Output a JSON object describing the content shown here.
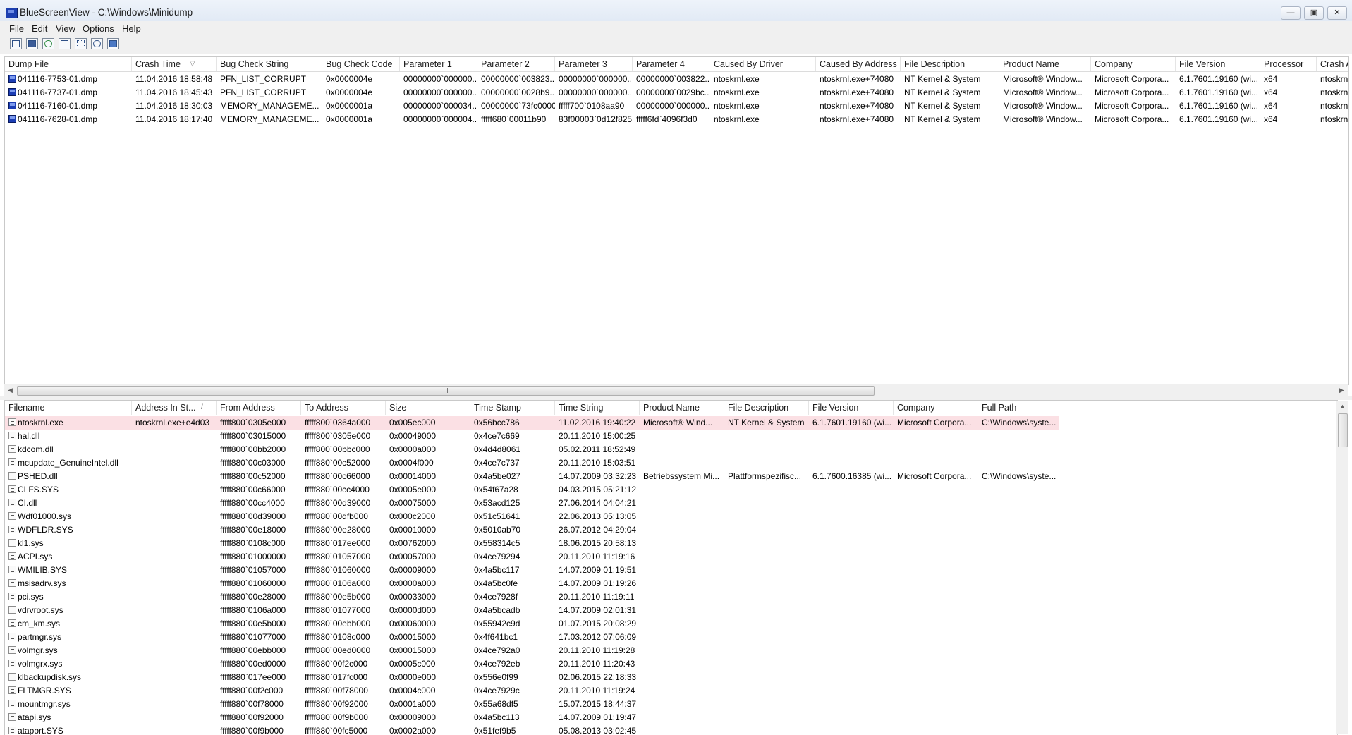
{
  "window": {
    "title": "BlueScreenView  -  C:\\Windows\\Minidump",
    "minimize": "—",
    "maximize": "▣",
    "close": "✕"
  },
  "menu": [
    "File",
    "Edit",
    "View",
    "Options",
    "Help"
  ],
  "toolbar": {
    "buttons": [
      "html-report-all-icon",
      "save-icon",
      "refresh-icon",
      "copy-icon",
      "properties-icon",
      "find-icon",
      "exit-icon"
    ]
  },
  "dumps": {
    "columns": [
      "Dump File",
      "Crash Time",
      "Bug Check String",
      "Bug Check Code",
      "Parameter 1",
      "Parameter 2",
      "Parameter 3",
      "Parameter 4",
      "Caused By Driver",
      "Caused By Address",
      "File Description",
      "Product Name",
      "Company",
      "File Version",
      "Processor",
      "Crash A"
    ],
    "sort_indicator": "▽",
    "rows": [
      [
        "041116-7753-01.dmp",
        "11.04.2016 18:58:48",
        "PFN_LIST_CORRUPT",
        "0x0000004e",
        "00000000`000000...",
        "00000000`003823...",
        "00000000`000000...",
        "00000000`003822...",
        "ntoskrnl.exe",
        "ntoskrnl.exe+74080",
        "NT Kernel & System",
        "Microsoft® Window...",
        "Microsoft Corpora...",
        "6.1.7601.19160 (wi...",
        "x64",
        "ntoskrn"
      ],
      [
        "041116-7737-01.dmp",
        "11.04.2016 18:45:43",
        "PFN_LIST_CORRUPT",
        "0x0000004e",
        "00000000`000000...",
        "00000000`0028b9...",
        "00000000`000000...",
        "00000000`0029bc...",
        "ntoskrnl.exe",
        "ntoskrnl.exe+74080",
        "NT Kernel & System",
        "Microsoft® Window...",
        "Microsoft Corpora...",
        "6.1.7601.19160 (wi...",
        "x64",
        "ntoskrn"
      ],
      [
        "041116-7160-01.dmp",
        "11.04.2016 18:30:03",
        "MEMORY_MANAGEME...",
        "0x0000001a",
        "00000000`000034...",
        "00000000`73fc0000",
        "fffff700`0108aa90",
        "00000000`000000...",
        "ntoskrnl.exe",
        "ntoskrnl.exe+74080",
        "NT Kernel & System",
        "Microsoft® Window...",
        "Microsoft Corpora...",
        "6.1.7601.19160 (wi...",
        "x64",
        "ntoskrn"
      ],
      [
        "041116-7628-01.dmp",
        "11.04.2016 18:17:40",
        "MEMORY_MANAGEME...",
        "0x0000001a",
        "00000000`000004...",
        "fffff680`00011b90",
        "83f00003`0d12f825",
        "fffff6fd`4096f3d0",
        "ntoskrnl.exe",
        "ntoskrnl.exe+74080",
        "NT Kernel & System",
        "Microsoft® Window...",
        "Microsoft Corpora...",
        "6.1.7601.19160 (wi...",
        "x64",
        "ntoskrn"
      ]
    ]
  },
  "hscroll": {
    "left": "◀",
    "right": "▶"
  },
  "drivers": {
    "columns": [
      "Filename",
      "Address In St...",
      "From Address",
      "To Address",
      "Size",
      "Time Stamp",
      "Time String",
      "Product Name",
      "File Description",
      "File Version",
      "Company",
      "Full Path"
    ],
    "sort_indicator": "/",
    "rows": [
      [
        "ntoskrnl.exe",
        "ntoskrnl.exe+e4d03",
        "fffff800`0305e000",
        "fffff800`0364a000",
        "0x005ec000",
        "0x56bcc786",
        "11.02.2016 19:40:22",
        "Microsoft® Wind...",
        "NT Kernel & System",
        "6.1.7601.19160 (wi...",
        "Microsoft Corpora...",
        "C:\\Windows\\syste..."
      ],
      [
        "hal.dll",
        "",
        "fffff800`03015000",
        "fffff800`0305e000",
        "0x00049000",
        "0x4ce7c669",
        "20.11.2010 15:00:25",
        "",
        "",
        "",
        "",
        ""
      ],
      [
        "kdcom.dll",
        "",
        "fffff800`00bb2000",
        "fffff800`00bbc000",
        "0x0000a000",
        "0x4d4d8061",
        "05.02.2011 18:52:49",
        "",
        "",
        "",
        "",
        ""
      ],
      [
        "mcupdate_GenuineIntel.dll",
        "",
        "fffff880`00c03000",
        "fffff880`00c52000",
        "0x0004f000",
        "0x4ce7c737",
        "20.11.2010 15:03:51",
        "",
        "",
        "",
        "",
        ""
      ],
      [
        "PSHED.dll",
        "",
        "fffff880`00c52000",
        "fffff880`00c66000",
        "0x00014000",
        "0x4a5be027",
        "14.07.2009 03:32:23",
        "Betriebssystem Mi...",
        "Plattformspezifisc...",
        "6.1.7600.16385 (wi...",
        "Microsoft Corpora...",
        "C:\\Windows\\syste..."
      ],
      [
        "CLFS.SYS",
        "",
        "fffff880`00c66000",
        "fffff880`00cc4000",
        "0x0005e000",
        "0x54f67a28",
        "04.03.2015 05:21:12",
        "",
        "",
        "",
        "",
        ""
      ],
      [
        "CI.dll",
        "",
        "fffff880`00cc4000",
        "fffff880`00d39000",
        "0x00075000",
        "0x53acd125",
        "27.06.2014 04:04:21",
        "",
        "",
        "",
        "",
        ""
      ],
      [
        "Wdf01000.sys",
        "",
        "fffff880`00d39000",
        "fffff880`00dfb000",
        "0x000c2000",
        "0x51c51641",
        "22.06.2013 05:13:05",
        "",
        "",
        "",
        "",
        ""
      ],
      [
        "WDFLDR.SYS",
        "",
        "fffff880`00e18000",
        "fffff880`00e28000",
        "0x00010000",
        "0x5010ab70",
        "26.07.2012 04:29:04",
        "",
        "",
        "",
        "",
        ""
      ],
      [
        "kl1.sys",
        "",
        "fffff880`0108c000",
        "fffff880`017ee000",
        "0x00762000",
        "0x558314c5",
        "18.06.2015 20:58:13",
        "",
        "",
        "",
        "",
        ""
      ],
      [
        "ACPI.sys",
        "",
        "fffff880`01000000",
        "fffff880`01057000",
        "0x00057000",
        "0x4ce79294",
        "20.11.2010 11:19:16",
        "",
        "",
        "",
        "",
        ""
      ],
      [
        "WMILIB.SYS",
        "",
        "fffff880`01057000",
        "fffff880`01060000",
        "0x00009000",
        "0x4a5bc117",
        "14.07.2009 01:19:51",
        "",
        "",
        "",
        "",
        ""
      ],
      [
        "msisadrv.sys",
        "",
        "fffff880`01060000",
        "fffff880`0106a000",
        "0x0000a000",
        "0x4a5bc0fe",
        "14.07.2009 01:19:26",
        "",
        "",
        "",
        "",
        ""
      ],
      [
        "pci.sys",
        "",
        "fffff880`00e28000",
        "fffff880`00e5b000",
        "0x00033000",
        "0x4ce7928f",
        "20.11.2010 11:19:11",
        "",
        "",
        "",
        "",
        ""
      ],
      [
        "vdrvroot.sys",
        "",
        "fffff880`0106a000",
        "fffff880`01077000",
        "0x0000d000",
        "0x4a5bcadb",
        "14.07.2009 02:01:31",
        "",
        "",
        "",
        "",
        ""
      ],
      [
        "cm_km.sys",
        "",
        "fffff880`00e5b000",
        "fffff880`00ebb000",
        "0x00060000",
        "0x55942c9d",
        "01.07.2015 20:08:29",
        "",
        "",
        "",
        "",
        ""
      ],
      [
        "partmgr.sys",
        "",
        "fffff880`01077000",
        "fffff880`0108c000",
        "0x00015000",
        "0x4f641bc1",
        "17.03.2012 07:06:09",
        "",
        "",
        "",
        "",
        ""
      ],
      [
        "volmgr.sys",
        "",
        "fffff880`00ebb000",
        "fffff880`00ed0000",
        "0x00015000",
        "0x4ce792a0",
        "20.11.2010 11:19:28",
        "",
        "",
        "",
        "",
        ""
      ],
      [
        "volmgrx.sys",
        "",
        "fffff880`00ed0000",
        "fffff880`00f2c000",
        "0x0005c000",
        "0x4ce792eb",
        "20.11.2010 11:20:43",
        "",
        "",
        "",
        "",
        ""
      ],
      [
        "klbackupdisk.sys",
        "",
        "fffff880`017ee000",
        "fffff880`017fc000",
        "0x0000e000",
        "0x556e0f99",
        "02.06.2015 22:18:33",
        "",
        "",
        "",
        "",
        ""
      ],
      [
        "FLTMGR.SYS",
        "",
        "fffff880`00f2c000",
        "fffff880`00f78000",
        "0x0004c000",
        "0x4ce7929c",
        "20.11.2010 11:19:24",
        "",
        "",
        "",
        "",
        ""
      ],
      [
        "mountmgr.sys",
        "",
        "fffff880`00f78000",
        "fffff880`00f92000",
        "0x0001a000",
        "0x55a68df5",
        "15.07.2015 18:44:37",
        "",
        "",
        "",
        "",
        ""
      ],
      [
        "atapi.sys",
        "",
        "fffff880`00f92000",
        "fffff880`00f9b000",
        "0x00009000",
        "0x4a5bc113",
        "14.07.2009 01:19:47",
        "",
        "",
        "",
        "",
        ""
      ],
      [
        "ataport.SYS",
        "",
        "fffff880`00f9b000",
        "fffff880`00fc5000",
        "0x0002a000",
        "0x51fef9b5",
        "05.08.2013 03:02:45",
        "",
        "",
        "",
        "",
        ""
      ]
    ]
  },
  "vscroll": {
    "up": "▲",
    "down": "▼"
  }
}
